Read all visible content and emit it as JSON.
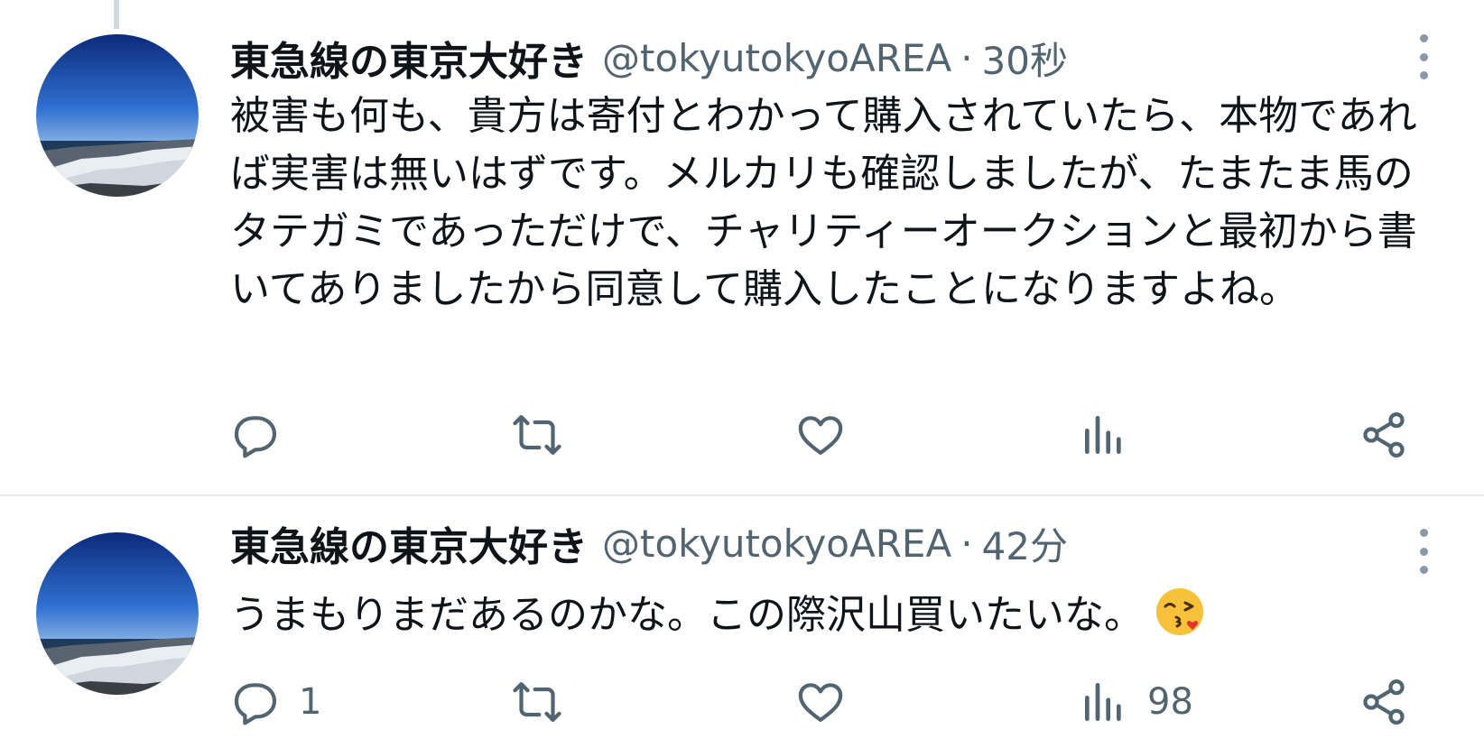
{
  "tweets": [
    {
      "author_name": "東急線の東京大好き",
      "handle": "@tokyutokyoAREA",
      "separator": "·",
      "time": "30秒",
      "text": "被害も何も、貴方は寄付とわかって購入されていたら、本物であれば実害は無いはずです。メルカリも確認しましたが、たまたま馬のタテガミであっただけで、チャリティーオークションと最初から書いてありましたから同意して購入したことになりますよね。",
      "replies": "",
      "reposts": "",
      "likes": "",
      "views": ""
    },
    {
      "author_name": "東急線の東京大好き",
      "handle": "@tokyutokyoAREA",
      "separator": "·",
      "time": "42分",
      "text": "うまもりまだあるのかな。この際沢山買いたいな。",
      "emoji": "face-blowing-a-kiss",
      "replies": "1",
      "reposts": "",
      "likes": "",
      "views": "98"
    }
  ],
  "icons": {
    "reply": "reply-icon",
    "repost": "repost-icon",
    "like": "like-icon",
    "views": "views-icon",
    "share": "share-icon",
    "more": "more-icon"
  },
  "colors": {
    "text": "#0f1419",
    "secondary": "#536471",
    "divider": "#e7eaee",
    "thread_line": "#cfd9de"
  }
}
